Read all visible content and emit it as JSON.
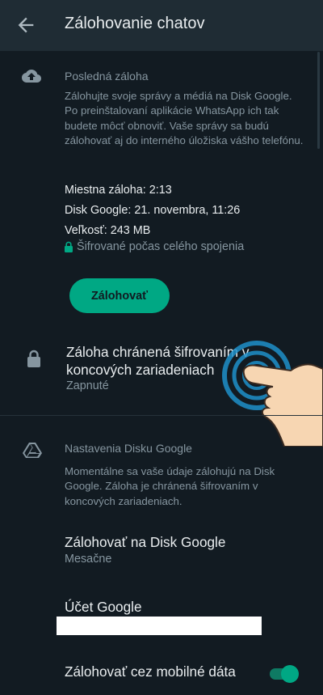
{
  "appbar": {
    "title": "Zálohovanie chatov",
    "back_icon": "arrow-left-icon"
  },
  "last_backup": {
    "title": "Posledná záloha",
    "icon": "cloud-upload-icon",
    "description": "Zálohujte svoje správy a médiá na Disk Google. Po preinštalovaní aplikácie WhatsApp ich tak budete môcť obnoviť. Vaše správy sa budú zálohovať aj do interného úložiska vášho telefónu.",
    "local": "Miestna záloha: 2:13",
    "google": "Disk Google: 21. novembra, 11:26",
    "size": "Veľkosť: 243 MB",
    "encrypted": "Šifrované počas celého spojenia",
    "button": "Zálohovať"
  },
  "e2e": {
    "icon": "lock-icon",
    "title": "Záloha chránená šifrovaním v koncových zariadeniach",
    "status": "Zapnuté"
  },
  "drive_settings": {
    "icon": "google-drive-icon",
    "title": "Nastavenia Disku Google",
    "description": "Momentálne sa vaše údaje zálohujú na Disk Google. Záloha je chránená šifrovaním v koncových zariadeniach.",
    "items": [
      {
        "title": "Zálohovať na Disk Google",
        "value": "Mesačne"
      },
      {
        "title": "Účet Google",
        "value": ""
      },
      {
        "title": "Zálohovať cez mobilné dáta",
        "value": ""
      }
    ],
    "mobile_data_enabled": true
  },
  "colors": {
    "accent": "#00a884",
    "background": "#121b22",
    "appbar": "#1f2c34"
  }
}
